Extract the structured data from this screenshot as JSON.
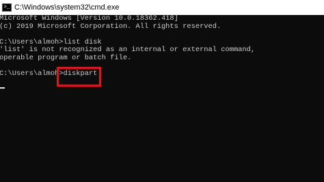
{
  "window": {
    "title": "C:\\Windows\\system32\\cmd.exe",
    "icon": "cmd-icon"
  },
  "console": {
    "lines": [
      "Microsoft Windows [Version 10.0.18362.418]",
      "(c) 2019 Microsoft Corporation. All rights reserved.",
      "",
      "C:\\Users\\almoh>list disk",
      "'list' is not recognized as an internal or external command,",
      "operable program or batch file.",
      "",
      "C:\\Users\\almoh>diskpart"
    ]
  },
  "highlight": {
    "text": "diskpart",
    "color": "#e0141b"
  }
}
